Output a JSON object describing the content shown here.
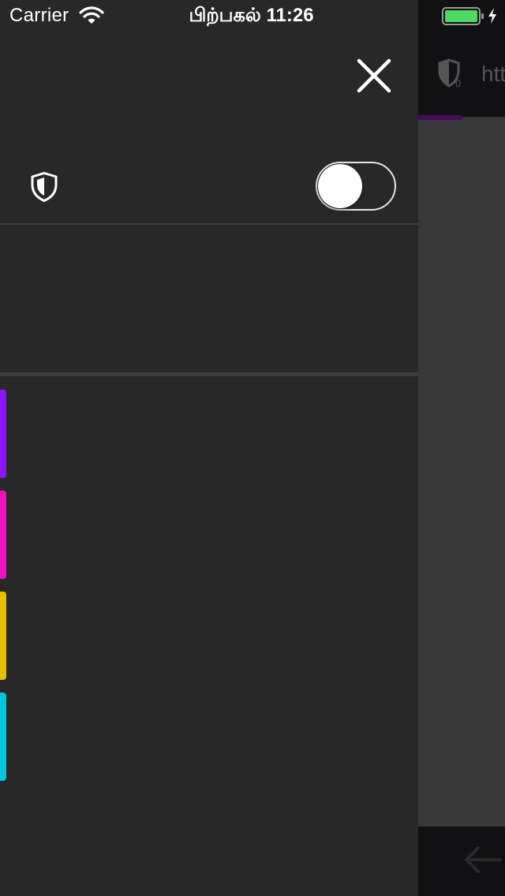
{
  "status_bar": {
    "carrier": "Carrier",
    "time": "பிற்பகல் 11:26",
    "icons": [
      "wifi-icon",
      "battery-icon",
      "charging-icon"
    ],
    "battery_color": "#4cd964"
  },
  "menu": {
    "close_icon": "close-icon",
    "tracking_protection": {
      "icon": "shield-icon",
      "toggle_on": false
    },
    "color_tabs": [
      {
        "name": "purple",
        "color": "#9013fe"
      },
      {
        "name": "magenta",
        "color": "#f012be"
      },
      {
        "name": "yellow",
        "color": "#e6c000"
      },
      {
        "name": "cyan",
        "color": "#00c8dc"
      }
    ]
  },
  "browser": {
    "url_text": "htt",
    "shield_icon": "shield-counter-icon",
    "tracker_count": "0",
    "back_icon": "back-arrow-icon"
  }
}
